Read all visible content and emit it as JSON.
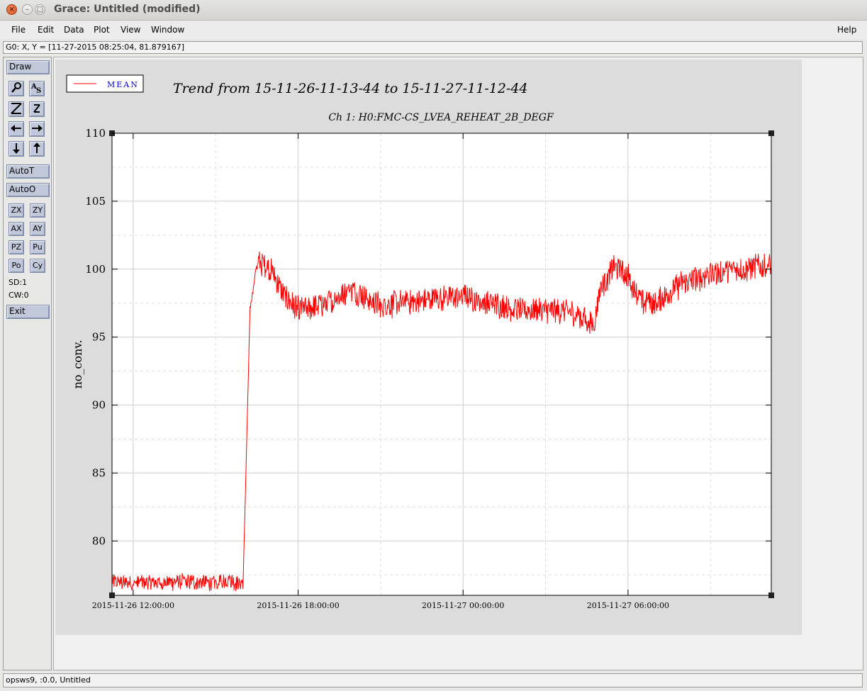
{
  "window": {
    "title": "Grace: Untitled (modified)",
    "controls": {
      "close": "×",
      "minimize": "–",
      "maximize": "□"
    }
  },
  "menubar": {
    "items": [
      {
        "label": "File"
      },
      {
        "label": "Edit"
      },
      {
        "label": "Data"
      },
      {
        "label": "Plot"
      },
      {
        "label": "View"
      },
      {
        "label": "Window"
      }
    ],
    "help": "Help"
  },
  "locator": {
    "text": "G0: X, Y = [11-27-2015 08:25:04, 81.879167]"
  },
  "toolbar": {
    "draw": "Draw",
    "icons": [
      "zoom-icon",
      "text-autoscale-icon",
      "zoom-xy-icon",
      "zoom-z-icon",
      "arrow-left-icon",
      "arrow-right-icon",
      "arrow-down-icon",
      "arrow-up-icon"
    ],
    "autot": "AutoT",
    "autoo": "AutoO",
    "zx": "ZX",
    "zy": "ZY",
    "ax": "AX",
    "ay": "AY",
    "pz": "PZ",
    "pu": "Pu",
    "po": "Po",
    "cy": "Cy",
    "sd": "SD:1",
    "cw": "CW:0",
    "exit": "Exit"
  },
  "status": {
    "text": "opsws9, :0.0, Untitled"
  },
  "chart_data": {
    "type": "line",
    "title": "Trend from 15-11-26-11-13-44 to 15-11-27-11-12-44",
    "subtitle": "Ch 1: H0:FMC-CS_LVEA_REHEAT_2B_DEGF",
    "ylabel": "no_conv.",
    "xlabel": "",
    "x_range": [
      "2015-11-26 11:13:44",
      "2015-11-27 11:12:44"
    ],
    "ylim": [
      76.0,
      110.0
    ],
    "yticks": [
      80,
      85,
      90,
      95,
      100,
      105,
      110
    ],
    "xticks": [
      "2015-11-26 12:00:00",
      "2015-11-26 18:00:00",
      "2015-11-27 00:00:00",
      "2015-11-27 06:00:00"
    ],
    "grid": true,
    "legend": {
      "position": "top-left",
      "entries": [
        {
          "name": "MEAN",
          "color": "#ff0000"
        }
      ]
    },
    "series": [
      {
        "name": "MEAN",
        "color": "#ff0000",
        "x": [
          "2015-11-26 11:14",
          "2015-11-26 12:00",
          "2015-11-26 13:00",
          "2015-11-26 14:00",
          "2015-11-26 15:00",
          "2015-11-26 15:30",
          "2015-11-26 15:45",
          "2015-11-26 16:00",
          "2015-11-26 16:15",
          "2015-11-26 16:30",
          "2015-11-26 17:00",
          "2015-11-26 17:30",
          "2015-11-26 18:00",
          "2015-11-26 18:30",
          "2015-11-26 19:00",
          "2015-11-26 20:00",
          "2015-11-26 21:00",
          "2015-11-26 22:00",
          "2015-11-27 00:00",
          "2015-11-27 02:00",
          "2015-11-27 03:00",
          "2015-11-27 04:00",
          "2015-11-27 04:45",
          "2015-11-27 05:00",
          "2015-11-27 05:30",
          "2015-11-27 06:00",
          "2015-11-27 06:30",
          "2015-11-27 07:00",
          "2015-11-27 08:00",
          "2015-11-27 09:00",
          "2015-11-27 10:00",
          "2015-11-27 11:12"
        ],
        "values": [
          77.0,
          76.9,
          77.0,
          77.0,
          76.9,
          77.2,
          76.9,
          77.0,
          97.0,
          100.5,
          100.0,
          98.0,
          97.0,
          97.2,
          97.5,
          98.5,
          97.3,
          97.6,
          98.0,
          97.0,
          97.0,
          96.8,
          96.0,
          98.5,
          100.2,
          99.5,
          97.5,
          97.5,
          99.0,
          99.6,
          100.0,
          100.3
        ]
      }
    ]
  }
}
